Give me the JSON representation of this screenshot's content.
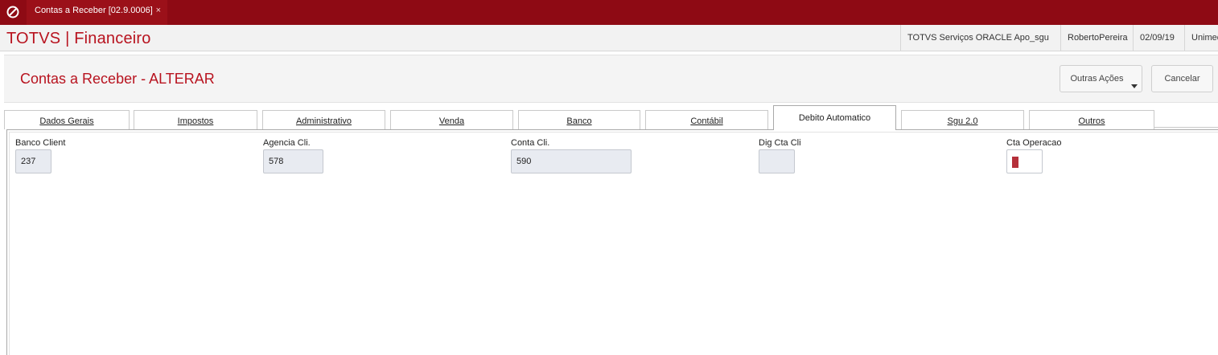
{
  "window": {
    "tab_title": "Contas a Receber [02.9.0006]",
    "tab_close": "×",
    "app_icon": "totvs-logo-icon"
  },
  "header": {
    "brand": "TOTVS | Financeiro",
    "environment": "TOTVS Serviços ORACLE Apo_sgu",
    "user": "RobertoPereira",
    "date": "02/09/19",
    "company": "Unimed"
  },
  "page": {
    "title": "Contas a Receber - ALTERAR",
    "actions": {
      "other_actions": "Outras Ações",
      "cancel": "Cancelar"
    }
  },
  "tabs": [
    {
      "label": "Dados Gerais",
      "active": false
    },
    {
      "label": "Impostos",
      "active": false
    },
    {
      "label": "Administrativo",
      "active": false
    },
    {
      "label": "Venda",
      "active": false
    },
    {
      "label": "Banco",
      "active": false
    },
    {
      "label": "Contábil",
      "active": false
    },
    {
      "label": "Debito Automatico",
      "active": true
    },
    {
      "label": "Sgu 2.0",
      "active": false
    },
    {
      "label": "Outros",
      "active": false
    }
  ],
  "form": {
    "banco_client": {
      "label": "Banco Client",
      "value": "237"
    },
    "agencia_cli": {
      "label": "Agencia Cli.",
      "value": "578"
    },
    "conta_cli": {
      "label": "Conta Cli.",
      "value": "590"
    },
    "dig_cta_cli": {
      "label": "Dig Cta Cli",
      "value": ""
    },
    "cta_operacao": {
      "label": "Cta Operacao",
      "value": ""
    }
  },
  "colors": {
    "topbar": "#8e0a14",
    "brand_red": "#b8131f",
    "readonly_field": "#e8ebf1"
  }
}
